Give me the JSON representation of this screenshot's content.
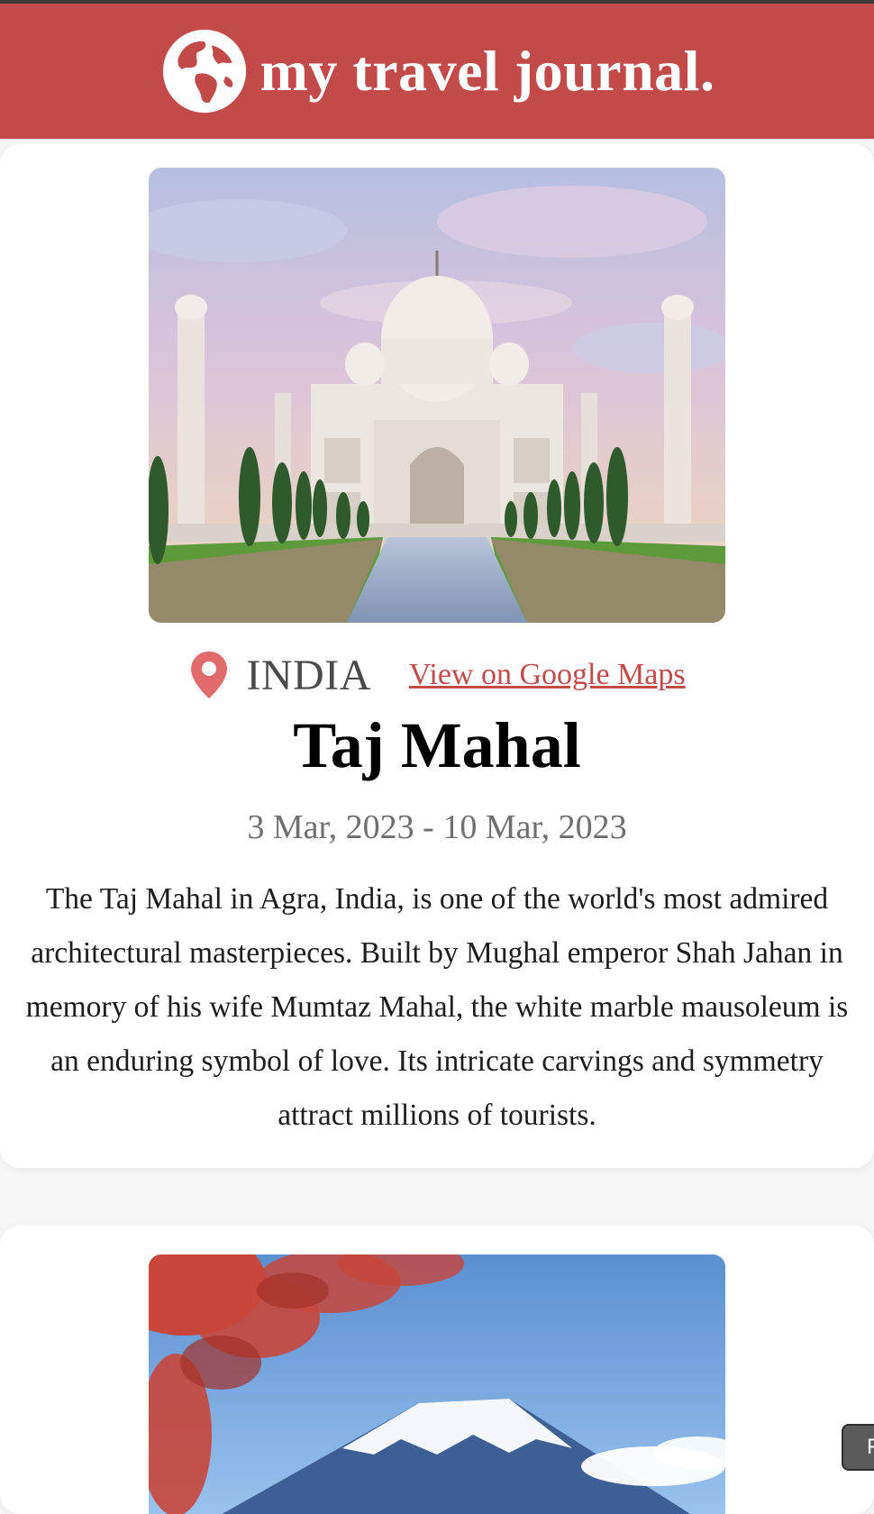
{
  "header": {
    "brand": "my travel journal.",
    "logo_icon": "globe-icon",
    "background": "#c24b4a"
  },
  "entries": [
    {
      "image_subject": "Taj Mahal",
      "location_icon": "map-pin-icon",
      "country": "INDIA",
      "map_link_label": "View on Google Maps",
      "title": "Taj Mahal",
      "dates": "3 Mar, 2023 - 10 Mar, 2023",
      "description": "The Taj Mahal in Agra, India, is one of the world's most admired architectural masterpieces. Built by Mughal emperor Shah Jahan in memory of his wife Mumtaz Mahal, the white marble mausoleum is an enduring symbol of love. Its intricate carvings and symmetry attract millions of tourists."
    },
    {
      "image_subject": "Mount Fuji"
    }
  ],
  "floating_button": {
    "label": "F"
  },
  "colors": {
    "accent": "#c24b4a",
    "muted_text": "#6f6f6f",
    "country_text": "#4a4a4a"
  }
}
